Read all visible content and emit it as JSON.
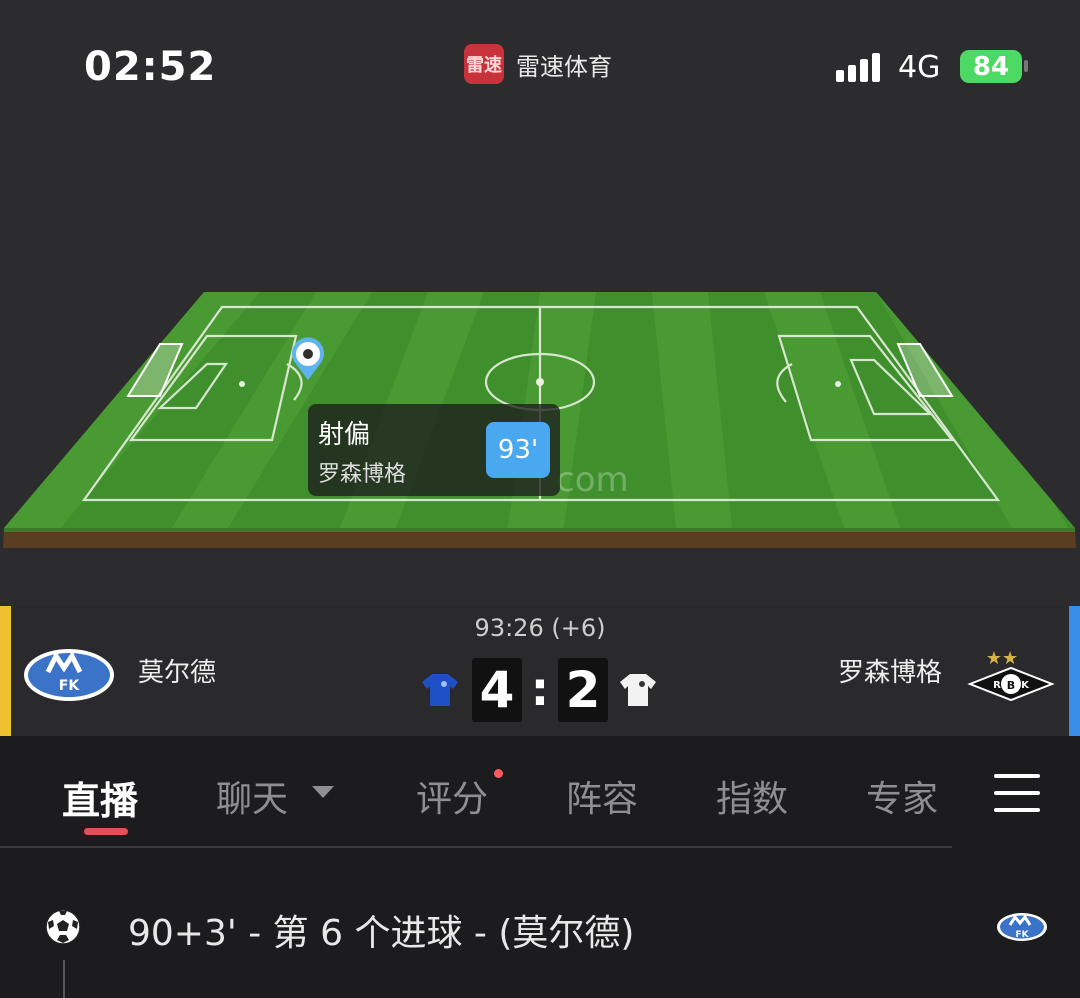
{
  "status_bar": {
    "time": "02:52",
    "app_name": "雷速体育",
    "app_logo_text": "雷速",
    "network": "4G",
    "battery": "84"
  },
  "pitch": {
    "watermark": "com",
    "event": {
      "type": "射偏",
      "team": "罗森博格",
      "minute": "93'"
    }
  },
  "match": {
    "clock": "93:26 (+6)",
    "home": {
      "name": "莫尔德",
      "score": "4",
      "color": "#f0c12e"
    },
    "away": {
      "name": "罗森博格",
      "score": "2",
      "color": "#3a8ee6"
    },
    "separator": ":"
  },
  "tabs": {
    "items": [
      {
        "label": "直播",
        "active": true
      },
      {
        "label": "聊天"
      },
      {
        "label": "评分"
      },
      {
        "label": "阵容"
      },
      {
        "label": "指数"
      },
      {
        "label": "专家"
      }
    ]
  },
  "timeline": {
    "event_text": "90+3' - 第 6 个进球 - (莫尔德)"
  }
}
